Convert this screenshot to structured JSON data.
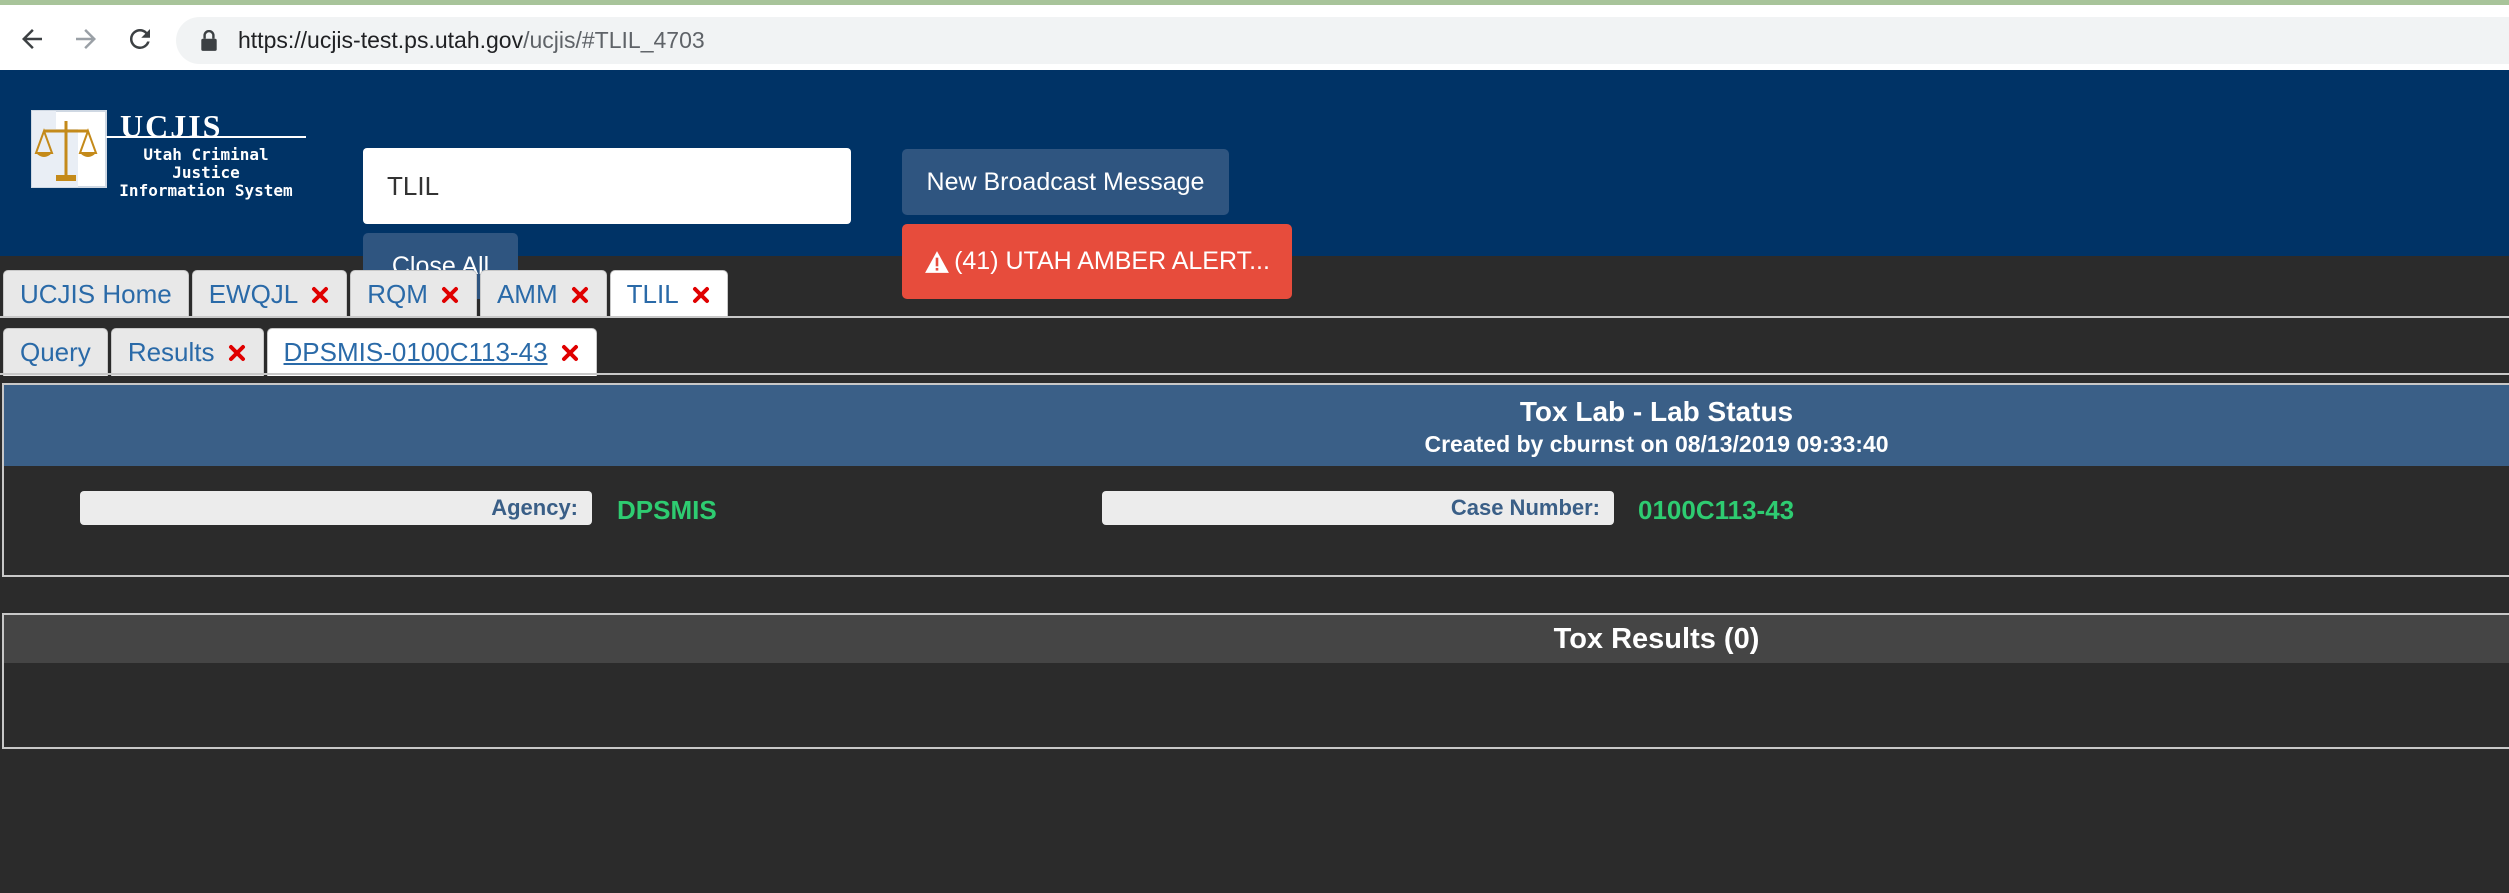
{
  "browser": {
    "url_host": "https://ucjis-test.ps.utah.gov",
    "url_path": "/ucjis/#TLIL_4703"
  },
  "header": {
    "logo_title": "UCJIS",
    "logo_sub_1": "Utah Criminal Justice",
    "logo_sub_2": "Information System",
    "search_value": "TLIL",
    "close_all_label": "Close All",
    "broadcast_label": "New Broadcast Message",
    "alert_label": "(41) UTAH AMBER ALERT..."
  },
  "main_tabs": [
    {
      "label": "UCJIS Home"
    },
    {
      "label": "EWQJL"
    },
    {
      "label": "RQM"
    },
    {
      "label": "AMM"
    },
    {
      "label": "TLIL"
    }
  ],
  "sub_tabs": [
    {
      "label": "Query"
    },
    {
      "label": "Results"
    },
    {
      "label": "DPSMIS-0100C113-43"
    }
  ],
  "lab_status": {
    "title": "Tox Lab - Lab Status",
    "subtitle": "Created by cburnst on 08/13/2019 09:33:40",
    "agency_label": "Agency:",
    "agency_value": "DPSMIS",
    "case_label": "Case Number:",
    "case_value": "0100C113-43"
  },
  "tox_results": {
    "title": "Tox Results (0)"
  },
  "colors": {
    "header_bg": "#003366",
    "alert": "#e74c3c",
    "value_green": "#2ecc71",
    "tab_text": "#2a6aa8",
    "close_red": "#e00000"
  }
}
